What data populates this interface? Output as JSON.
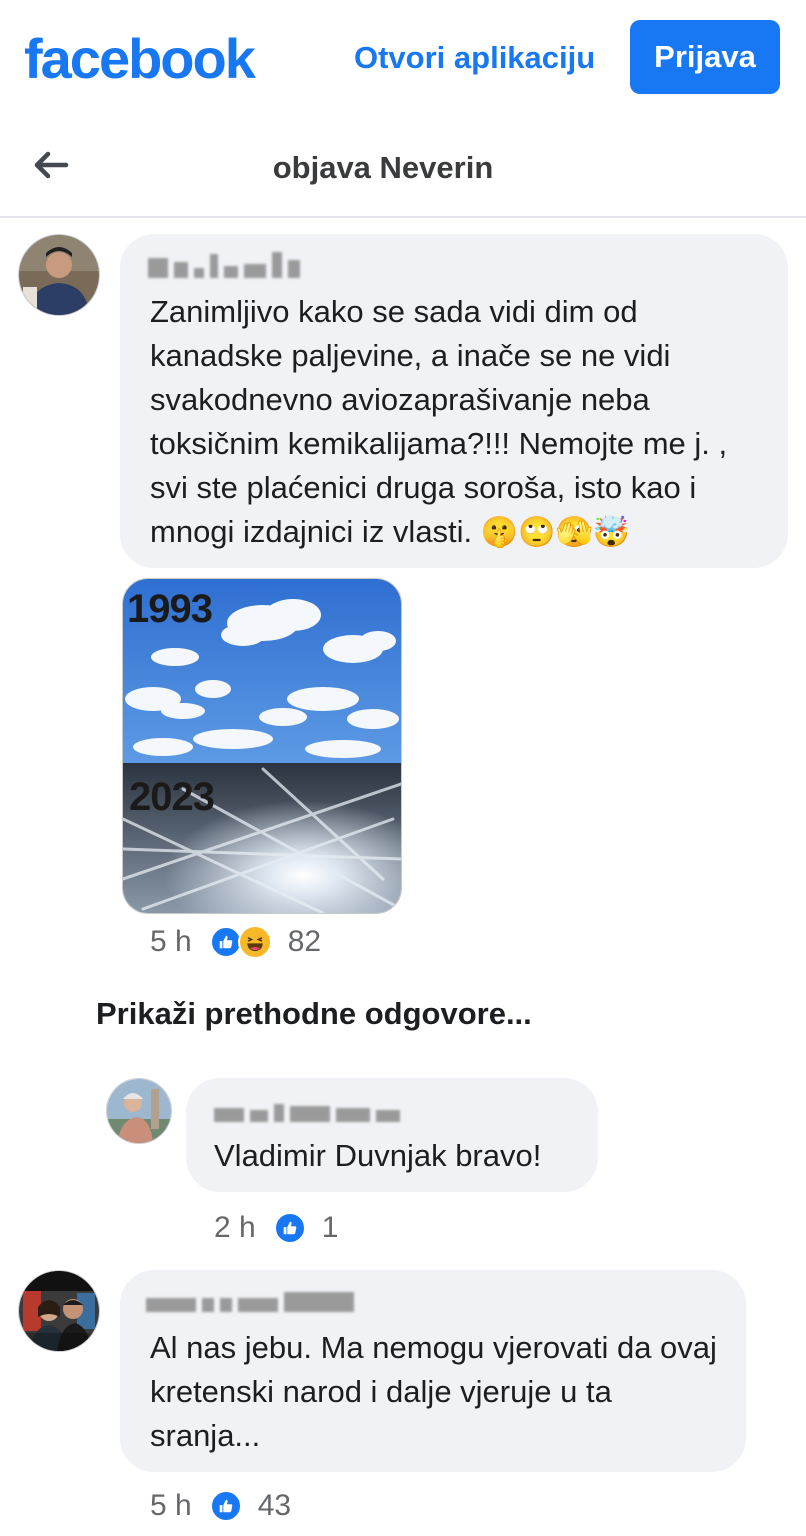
{
  "topbar": {
    "logo_text": "facebook",
    "open_app_label": "Otvori aplikaciju",
    "login_label": "Prijava"
  },
  "subheader": {
    "title": "objava Neverin"
  },
  "comments": [
    {
      "text": "Zanimljivo kako se sada vidi dim od kanadske paljevine, a inače se ne vidi svakodnevno aviozaprašivanje neba toksičnim kemikalijama?!!! Nemojte me j. , svi ste plaćenici druga soroša, isto kao i mnogi izdajnici iz vlasti.",
      "emojis": "🤫🙄🫣🤯",
      "image": {
        "top_label": "1993",
        "bottom_label": "2023"
      },
      "time": "5 h",
      "reaction_count": "82",
      "reactions": [
        "like-icon",
        "haha-icon"
      ]
    }
  ],
  "show_previous_label": "Prikaži prethodne odgovore...",
  "replies": [
    {
      "text": "Vladimir Duvnjak bravo!",
      "time": "2 h",
      "reaction_count": "1",
      "reactions": [
        "like-icon"
      ]
    }
  ],
  "second_comment": {
    "text": "Al nas jebu. Ma nemogu vjerovati da ovaj kretenski narod i dalje vjeruje u ta sranja...",
    "time": "5 h",
    "reaction_count": "43",
    "reactions": [
      "like-icon"
    ]
  },
  "colors": {
    "brand": "#1877f2",
    "bubble": "#f0f2f5",
    "meta_text": "#65676b"
  }
}
